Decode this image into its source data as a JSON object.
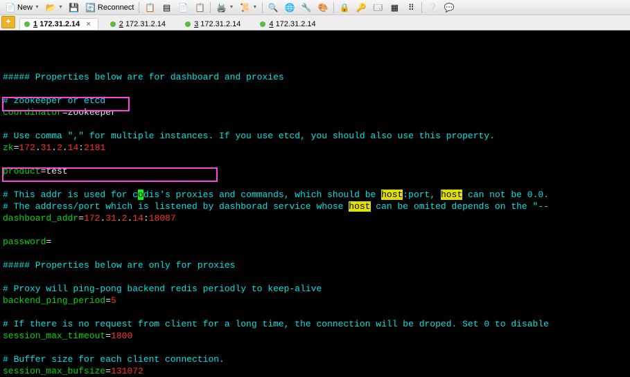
{
  "toolbar": {
    "new_label": "New",
    "reconnect_label": "Reconnect"
  },
  "tabs": [
    {
      "num": "1",
      "ip": "172.31.2.14",
      "active": true,
      "closable": true
    },
    {
      "num": "2",
      "ip": "172.31.2.14",
      "active": false,
      "closable": false
    },
    {
      "num": "3",
      "ip": "172.31.2.14",
      "active": false,
      "closable": false
    },
    {
      "num": "4",
      "ip": "172.31.2.14",
      "active": false,
      "closable": false
    }
  ],
  "term": {
    "l1": "##### Properties below are for dashboard and proxies",
    "l3": "# zookeeper or etcd",
    "l4a": "coordinator",
    "l4b": "=",
    "l4c": "zookeeper",
    "l6": "# Use comma \",\" for multiple instances. If you use etcd, you should also use this property.",
    "l7a": "zk",
    "l7b": "=",
    "l7c": "172",
    "l7d": ".",
    "l7e": "31",
    "l7f": ".",
    "l7g": "2",
    "l7h": ".",
    "l7i": "14",
    "l7j": ":",
    "l7k": "2181",
    "l9a": "product",
    "l9b": "=",
    "l9c": "test",
    "l11a": "# This addr is used for c",
    "l11b": "o",
    "l11c": "dis's proxies and commands, which should be ",
    "l11d": "host",
    "l11e": ":port, ",
    "l11f": "host",
    "l11g": " can not be 0.0.",
    "l12a": "# The address/port which is listened by dashborad service whose ",
    "l12b": "host",
    "l12c": " can be omited depends on the \"--",
    "l13a": "dashboard_addr",
    "l13b": "=",
    "l13c": "172",
    "l13d": ".",
    "l13e": "31",
    "l13f": ".",
    "l13g": "2",
    "l13h": ".",
    "l13i": "14",
    "l13j": ":",
    "l13k": "18087",
    "l15a": "password",
    "l15b": "=",
    "l17": "##### Properties below are only for proxies",
    "l19": "# Proxy will ping-pong backend redis periodly to keep-alive",
    "l20a": "backend_ping_period",
    "l20b": "=",
    "l20c": "5",
    "l22": "# If there is no request from client for a long time, the connection will be droped. Set 0 to disable",
    "l23a": "session_max_timeout",
    "l23b": "=",
    "l23c": "1800",
    "l25": "# Buffer size for each client connection.",
    "l26a": "session_max_bufsize",
    "l26b": "=",
    "l26c": "131072"
  }
}
